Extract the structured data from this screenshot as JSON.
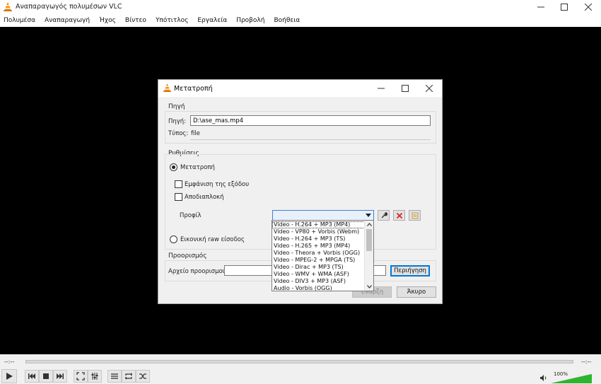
{
  "window": {
    "title": "Αναπαραγωγός πολυμέσων VLC"
  },
  "menu": [
    "Πολυμέσα",
    "Αναπαραγωγή",
    "Ήχος",
    "Βίντεο",
    "Υπότιτλος",
    "Εργαλεία",
    "Προβολή",
    "Βοήθεια"
  ],
  "player": {
    "time_elapsed": "--:--",
    "time_total": "--:--",
    "volume": "100%",
    "volume_level": 1.0
  },
  "dialog": {
    "title": "Μετατροπή",
    "source": {
      "group_title": "Πηγή",
      "source_label": "Πηγή:",
      "source_value": "D:\\ase_mas.mp4",
      "type_label": "Τύπος:",
      "type_value": "file"
    },
    "settings": {
      "group_title": "Ρυθμίσεις",
      "convert_label": "Μετατροπή",
      "show_output_label": "Εμφάνιση της εξόδου",
      "deinterlace_label": "Αποδιαπλοκή",
      "profile_label": "Προφίλ",
      "raw_input_label": "Εικονική raw είσοδος"
    },
    "destination": {
      "group_title": "Προορισμός",
      "file_label": "Αρχείο προορισμού:",
      "file_value": "",
      "browse_label": "Περιήγηση"
    },
    "start_label": "Έναρξη",
    "cancel_label": "Άκυρο"
  },
  "profile_options": [
    "Video - H.264 + MP3 (MP4)",
    "Video - VP80 + Vorbis (Webm)",
    "Video - H.264 + MP3 (TS)",
    "Video - H.265 + MP3 (MP4)",
    "Video - Theora + Vorbis (OGG)",
    "Video - MPEG-2 + MPGA (TS)",
    "Video - Dirac + MP3 (TS)",
    "Video - WMV + WMA (ASF)",
    "Video - DIV3 + MP3 (ASF)",
    "Audio - Vorbis (OGG)"
  ],
  "colors": {
    "accent": "#0078d7",
    "vlc_orange": "#f08a00",
    "volume_green": "#2db52d"
  }
}
